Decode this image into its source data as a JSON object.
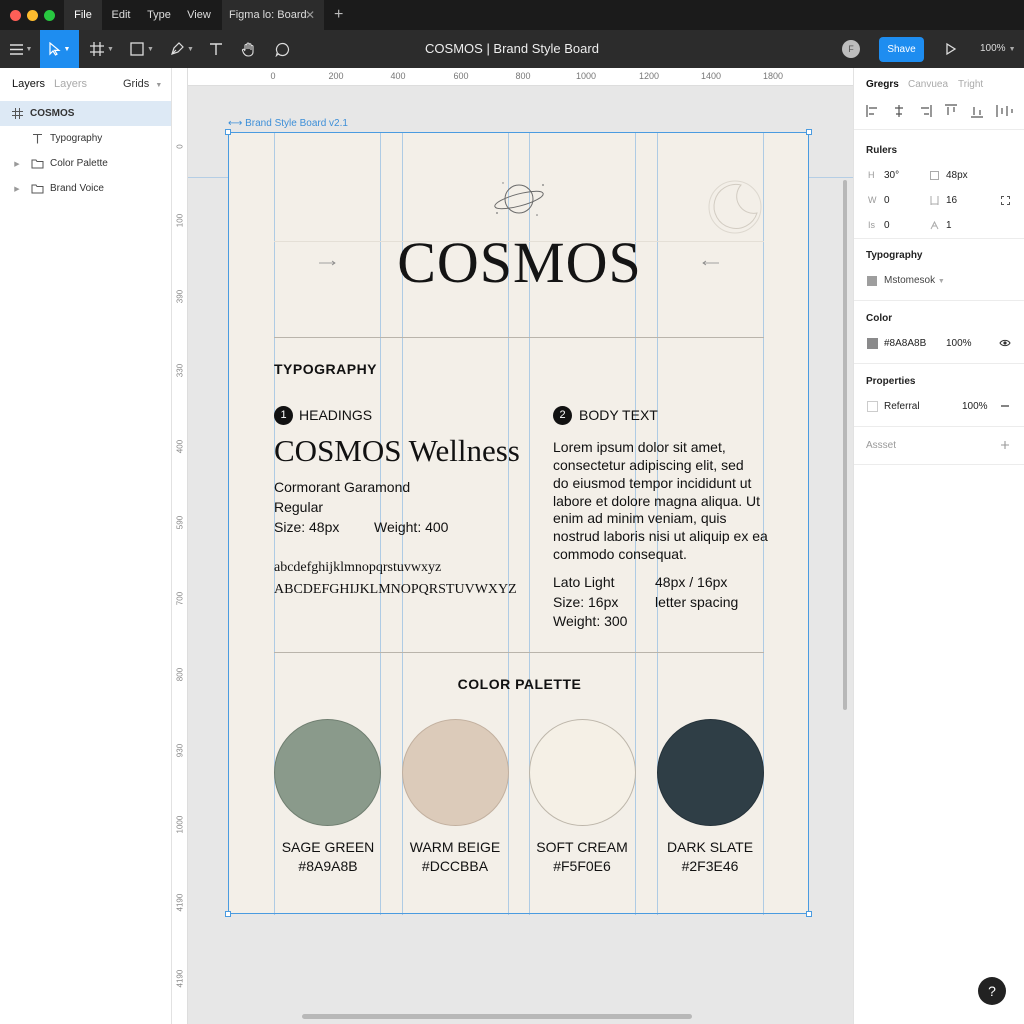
{
  "titlebar": {
    "menus": [
      "File",
      "Edit",
      "Type",
      "View"
    ],
    "tab_label": "Figma lo: Board",
    "new_tab": "+",
    "close": "✕"
  },
  "toolbar": {
    "title": "COSMOS | Brand Style Board",
    "share": "Shave",
    "zoom": "100%",
    "avatar_initial": "F"
  },
  "left_panel": {
    "tabs": [
      "Layers",
      "Layers",
      "Grids"
    ],
    "layers": [
      {
        "name": "COSMOS",
        "icon": "frame-icon"
      },
      {
        "name": "Typography",
        "icon": "text-icon"
      },
      {
        "name": "Color Palette",
        "icon": "folder-icon"
      },
      {
        "name": "Brand Voice",
        "icon": "folder-icon"
      }
    ]
  },
  "right_panel": {
    "tabs": [
      "Gregrs",
      "Canvuea",
      "Tright"
    ],
    "rulers": {
      "heading": "Rulers",
      "h_label": "H",
      "h_value": "30°",
      "size_value": "48px",
      "w_label": "W",
      "w_value": "0",
      "lh_value": "16",
      "is_label": "Is",
      "is_value": "0",
      "ls_value": "1"
    },
    "typography": {
      "heading": "Typography",
      "font": "Mstomesok"
    },
    "color": {
      "heading": "Color",
      "hex": "#8A8A8B",
      "opacity": "100%"
    },
    "properties": {
      "heading": "Properties",
      "name": "Referral",
      "value": "100%"
    },
    "asset": {
      "label": "Assset"
    }
  },
  "canvas": {
    "ruler_top": [
      "0",
      "200",
      "400",
      "600",
      "800",
      "1000",
      "1200",
      "1400",
      "1800"
    ],
    "ruler_left": [
      "0",
      "100",
      "390",
      "330",
      "400",
      "590",
      "700",
      "800",
      "930",
      "1000",
      "4190",
      "4190"
    ],
    "frame_label": "⟷ Brand Style Board v2.1"
  },
  "board": {
    "title": "COSMOS",
    "typography_heading": "TYPOGRAPHY",
    "headings": {
      "number": "1",
      "label": "HEADINGS",
      "sample": "COSMOS Wellness",
      "font": "Cormorant Garamond",
      "style": "Regular",
      "size": "Size: 48px",
      "weight": "Weight: 400",
      "lower": "abcdefghijklmnopqrstuvwxyz",
      "upper": "ABCDEFGHIJKLMNOPQRSTUVWXYZ"
    },
    "body": {
      "number": "2",
      "label": "BODY TEXT",
      "lines": [
        "Lorem ipsum dolor sit amet,",
        "consectetur adipiscing elit, sed",
        "do eiusmod tempor incididunt ut",
        "labore et dolore magna aliqua. Ut",
        "enim ad minim veniam, quis",
        "nostrud laboris nisi ut aliquip ex ea",
        "commodo consequat."
      ],
      "font": "Lato Light",
      "size": "Size: 16px",
      "weight": "Weight: 300",
      "line_height": "48px / 16px",
      "spacing": "letter spacing"
    },
    "palette_heading": "COLOR PALETTE",
    "swatches": [
      {
        "name": "SAGE GREEN",
        "hex": "#8A9A8B"
      },
      {
        "name": "WARM BEIGE",
        "hex": "#DCCBBA"
      },
      {
        "name": "SOFT CREAM",
        "hex": "#F5F0E6"
      },
      {
        "name": "DARK SLATE",
        "hex": "#2F3E46"
      }
    ]
  },
  "help": "?"
}
